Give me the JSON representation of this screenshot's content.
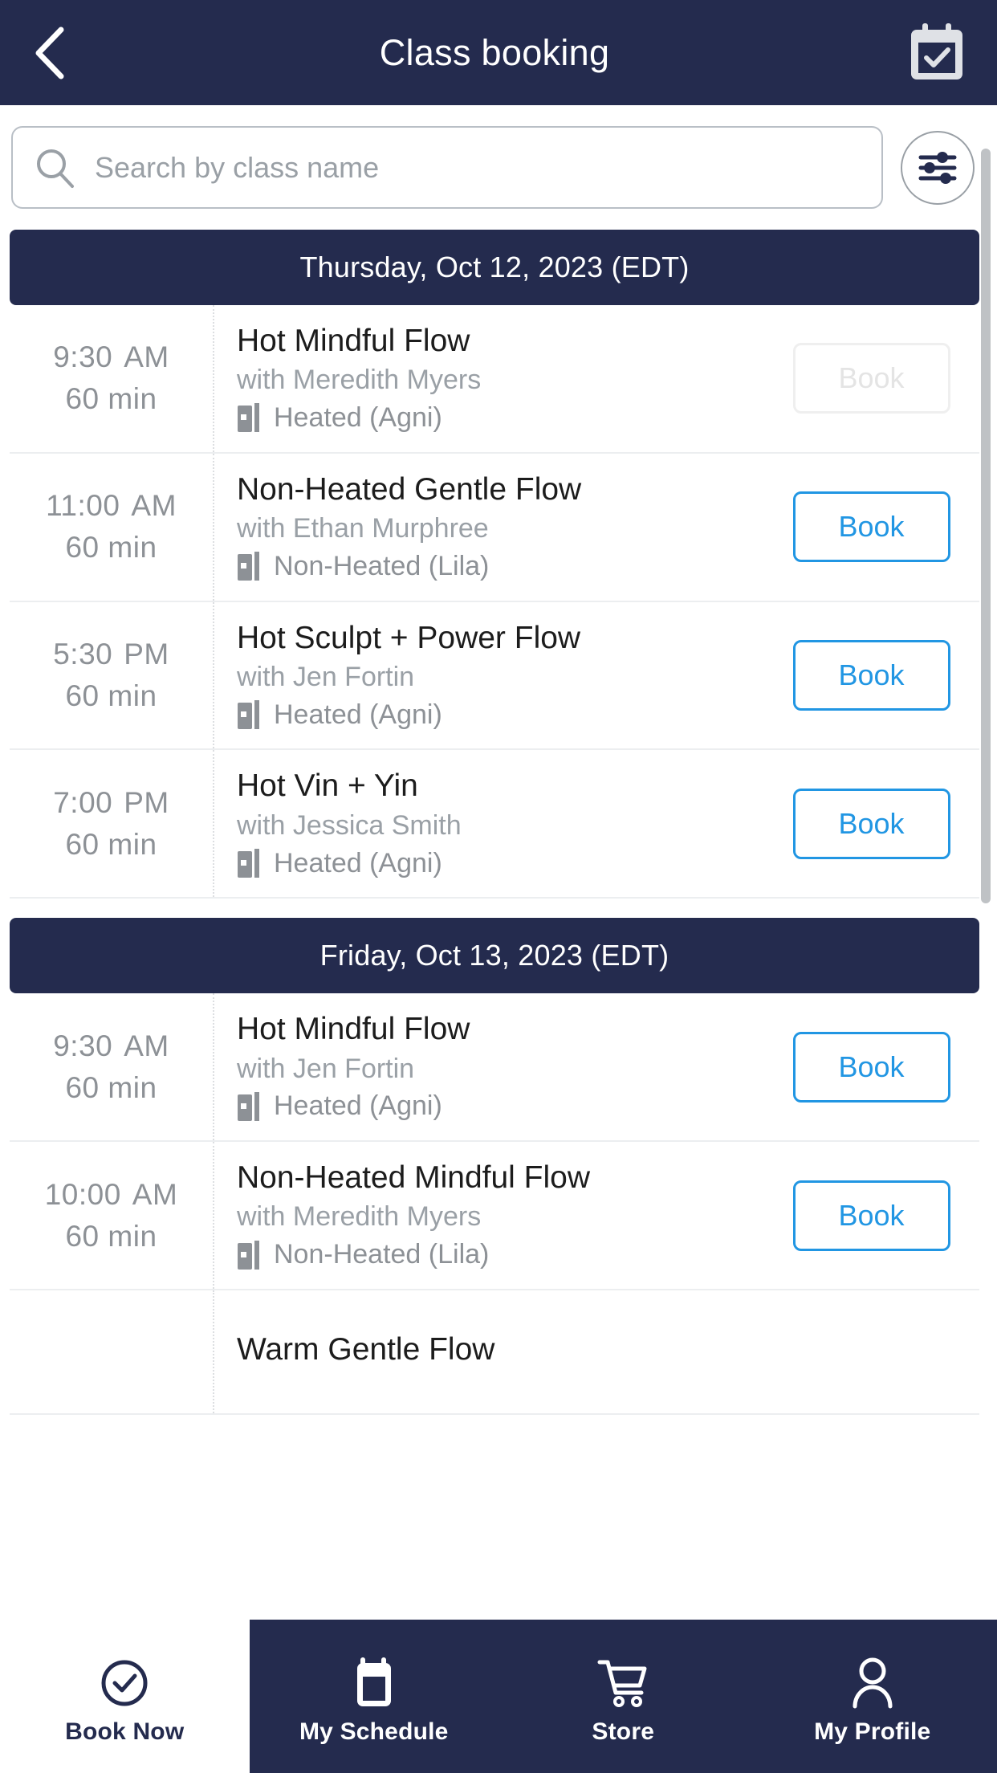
{
  "header": {
    "title": "Class booking",
    "back_icon": "chevron-left-icon",
    "calendar_icon": "calendar-check-icon"
  },
  "search": {
    "placeholder": "Search by class name",
    "value": "",
    "search_icon": "search-icon",
    "filter_icon": "sliders-filter-icon"
  },
  "colors": {
    "navy": "#242b4e",
    "accent_blue": "#2196e3",
    "muted_gray": "#9aa0a6",
    "disabled_gray": "#e4e4e4"
  },
  "days": [
    {
      "label": "Thursday, Oct 12, 2023 (EDT)",
      "classes": [
        {
          "time": "9:30",
          "ampm": "AM",
          "duration": "60 min",
          "name": "Hot Mindful Flow",
          "teacher": "with Meredith Myers",
          "room": "Heated (Agni)",
          "room_icon": "door-icon",
          "book_label": "Book",
          "book_enabled": false
        },
        {
          "time": "11:00",
          "ampm": "AM",
          "duration": "60 min",
          "name": "Non-Heated Gentle Flow",
          "teacher": "with Ethan Murphree",
          "room": "Non-Heated (Lila)",
          "room_icon": "door-icon",
          "book_label": "Book",
          "book_enabled": true
        },
        {
          "time": "5:30",
          "ampm": "PM",
          "duration": "60 min",
          "name": "Hot Sculpt + Power Flow",
          "teacher": "with Jen Fortin",
          "room": "Heated (Agni)",
          "room_icon": "door-icon",
          "book_label": "Book",
          "book_enabled": true
        },
        {
          "time": "7:00",
          "ampm": "PM",
          "duration": "60 min",
          "name": "Hot Vin + Yin",
          "teacher": "with Jessica Smith",
          "room": "Heated (Agni)",
          "room_icon": "door-icon",
          "book_label": "Book",
          "book_enabled": true
        }
      ]
    },
    {
      "label": "Friday, Oct 13, 2023 (EDT)",
      "classes": [
        {
          "time": "9:30",
          "ampm": "AM",
          "duration": "60 min",
          "name": "Hot Mindful Flow",
          "teacher": "with Jen Fortin",
          "room": "Heated (Agni)",
          "room_icon": "door-icon",
          "book_label": "Book",
          "book_enabled": true
        },
        {
          "time": "10:00",
          "ampm": "AM",
          "duration": "60 min",
          "name": "Non-Heated Mindful Flow",
          "teacher": "with Meredith Myers",
          "room": "Non-Heated (Lila)",
          "room_icon": "door-icon",
          "book_label": "Book",
          "book_enabled": true
        },
        {
          "time": "",
          "ampm": "",
          "duration": "",
          "name": "Warm Gentle Flow",
          "teacher": "",
          "room": "",
          "room_icon": "door-icon",
          "book_label": "",
          "book_enabled": true
        }
      ]
    }
  ],
  "bottom_nav": [
    {
      "label": "Book Now",
      "icon": "check-circle-icon",
      "active": true
    },
    {
      "label": "My Schedule",
      "icon": "calendar-icon",
      "active": false
    },
    {
      "label": "Store",
      "icon": "shopping-cart-icon",
      "active": false
    },
    {
      "label": "My Profile",
      "icon": "person-icon",
      "active": false
    }
  ]
}
